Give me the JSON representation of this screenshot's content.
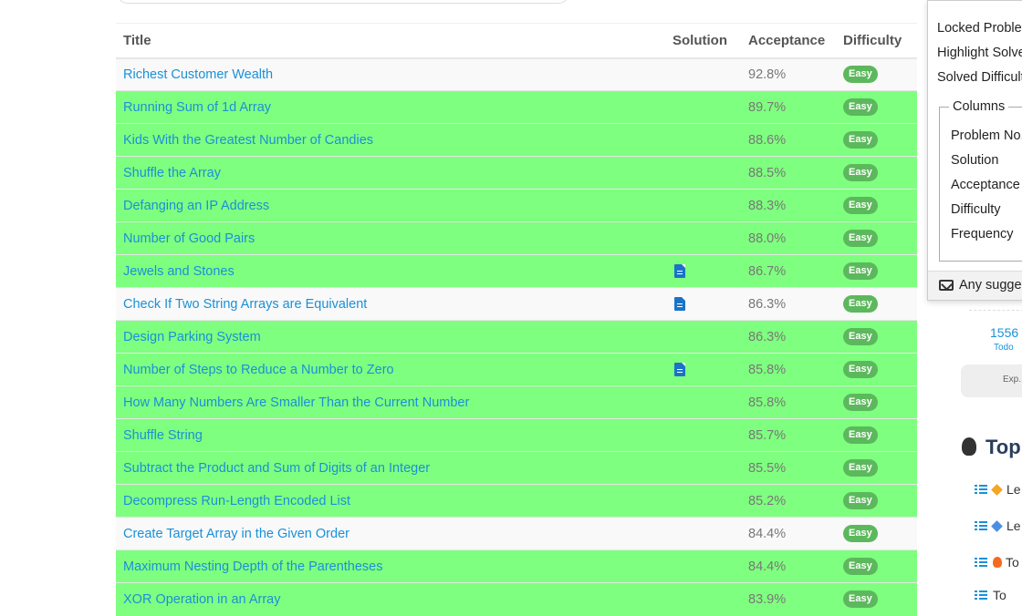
{
  "table": {
    "headers": {
      "title": "Title",
      "solution": "Solution",
      "acceptance": "Acceptance",
      "difficulty": "Difficulty"
    },
    "rows": [
      {
        "title": "Richest Customer Wealth",
        "solution": false,
        "acceptance": "92.8%",
        "difficulty": "Easy",
        "solved": false
      },
      {
        "title": "Running Sum of 1d Array",
        "solution": false,
        "acceptance": "89.7%",
        "difficulty": "Easy",
        "solved": true
      },
      {
        "title": "Kids With the Greatest Number of Candies",
        "solution": false,
        "acceptance": "88.6%",
        "difficulty": "Easy",
        "solved": true
      },
      {
        "title": "Shuffle the Array",
        "solution": false,
        "acceptance": "88.5%",
        "difficulty": "Easy",
        "solved": true
      },
      {
        "title": "Defanging an IP Address",
        "solution": false,
        "acceptance": "88.3%",
        "difficulty": "Easy",
        "solved": true
      },
      {
        "title": "Number of Good Pairs",
        "solution": false,
        "acceptance": "88.0%",
        "difficulty": "Easy",
        "solved": true
      },
      {
        "title": "Jewels and Stones",
        "solution": true,
        "acceptance": "86.7%",
        "difficulty": "Easy",
        "solved": true
      },
      {
        "title": "Check If Two String Arrays are Equivalent",
        "solution": true,
        "acceptance": "86.3%",
        "difficulty": "Easy",
        "solved": false
      },
      {
        "title": "Design Parking System",
        "solution": false,
        "acceptance": "86.3%",
        "difficulty": "Easy",
        "solved": true
      },
      {
        "title": "Number of Steps to Reduce a Number to Zero",
        "solution": true,
        "acceptance": "85.8%",
        "difficulty": "Easy",
        "solved": true
      },
      {
        "title": "How Many Numbers Are Smaller Than the Current Number",
        "solution": false,
        "acceptance": "85.8%",
        "difficulty": "Easy",
        "solved": true
      },
      {
        "title": "Shuffle String",
        "solution": false,
        "acceptance": "85.7%",
        "difficulty": "Easy",
        "solved": true
      },
      {
        "title": "Subtract the Product and Sum of Digits of an Integer",
        "solution": false,
        "acceptance": "85.5%",
        "difficulty": "Easy",
        "solved": true
      },
      {
        "title": "Decompress Run-Length Encoded List",
        "solution": false,
        "acceptance": "85.2%",
        "difficulty": "Easy",
        "solved": true
      },
      {
        "title": "Create Target Array in the Given Order",
        "solution": false,
        "acceptance": "84.4%",
        "difficulty": "Easy",
        "solved": false
      },
      {
        "title": "Maximum Nesting Depth of the Parentheses",
        "solution": false,
        "acceptance": "84.4%",
        "difficulty": "Easy",
        "solved": true
      },
      {
        "title": "XOR Operation in an Array",
        "solution": false,
        "acceptance": "83.9%",
        "difficulty": "Easy",
        "solved": true
      }
    ]
  },
  "menu": {
    "items": [
      "Locked Problems",
      "Highlight Solved",
      "Solved Difficulty"
    ],
    "columns_legend": "Columns",
    "columns": [
      "Problem No.",
      "Solution",
      "Acceptance",
      "Difficulty",
      "Frequency"
    ],
    "footer": "Any suggestions?"
  },
  "progress": {
    "todo_count": "1556",
    "todo_label": "Todo",
    "exp_label": "Exp."
  },
  "top": {
    "title": "Top",
    "items": [
      {
        "marker": "orange",
        "label": "Le"
      },
      {
        "marker": "blue",
        "label": "Le"
      },
      {
        "marker": "fire",
        "label": "To"
      },
      {
        "marker": "none",
        "label": "To"
      }
    ]
  },
  "colors": {
    "solved_row": "#7fff7f",
    "link": "#1a90d9",
    "easy_badge": "#5cb85c"
  },
  "icons": {
    "solution": "document-icon",
    "mail": "mail-icon",
    "top": "flame-icon",
    "list": "list-icon"
  }
}
